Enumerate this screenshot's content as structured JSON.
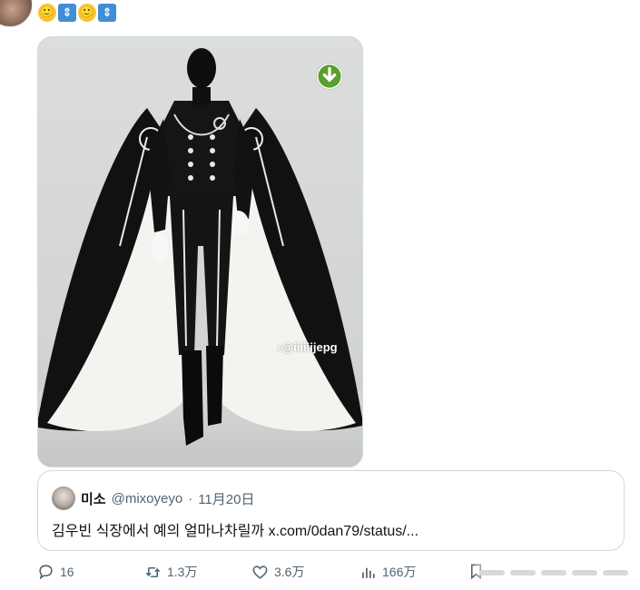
{
  "post": {
    "emojis": [
      {
        "kind": "smile",
        "glyph": "🙂"
      },
      {
        "kind": "updown",
        "glyph": "⇕"
      },
      {
        "kind": "smile",
        "glyph": "🙂"
      },
      {
        "kind": "updown",
        "glyph": "⇕"
      }
    ]
  },
  "media": {
    "watermark": "♪@iiiiiijepg",
    "alt_icon": "download-icon"
  },
  "quote": {
    "name": "미소",
    "handle": "@mixoyeyo",
    "separator": "·",
    "date": "11月20日",
    "text": "김우빈 식장에서 예의 얼마나차릴까 x.com/0dan79/status/..."
  },
  "actions": {
    "reply_count": "16",
    "retweet_count": "1.3万",
    "like_count": "3.6万",
    "views_count": "166万"
  },
  "colors": {
    "muted": "#536471",
    "border": "#cfd9de",
    "download_green": "#5aa02c"
  }
}
